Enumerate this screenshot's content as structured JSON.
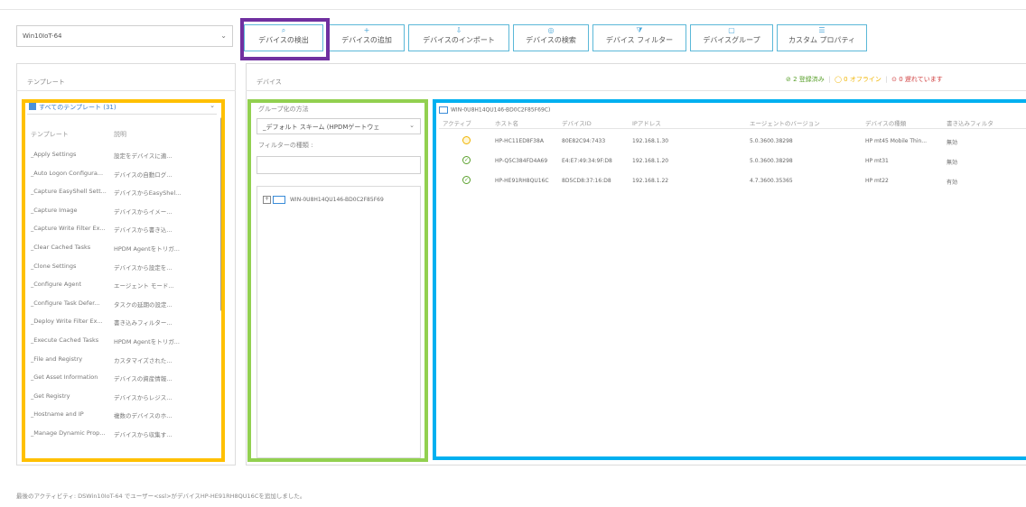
{
  "os_select": {
    "value": "Win10IoT-64"
  },
  "toolbar": [
    {
      "key": "detect",
      "label": "デバイスの検出",
      "icon": "search-icon",
      "glyph": "⌕"
    },
    {
      "key": "add",
      "label": "デバイスの追加",
      "icon": "plus-icon",
      "glyph": "+"
    },
    {
      "key": "import",
      "label": "デバイスのインポート",
      "icon": "import-icon",
      "glyph": "⇩"
    },
    {
      "key": "search",
      "label": "デバイスの検索",
      "icon": "find-icon",
      "glyph": "◎"
    },
    {
      "key": "filter",
      "label": "デバイス フィルター",
      "icon": "filter-icon",
      "glyph": "⧩"
    },
    {
      "key": "group",
      "label": "デバイスグループ",
      "icon": "group-icon",
      "glyph": "▢"
    },
    {
      "key": "props",
      "label": "カスタム プロパティ",
      "icon": "properties-icon",
      "glyph": "☰"
    }
  ],
  "templates": {
    "title": "テンプレート",
    "dropdown": "すべてのテンプレート (31)",
    "col_name": "テンプレート",
    "col_desc": "説明",
    "rows": [
      {
        "name": "_Apply Settings",
        "desc": "設定をデバイスに適..."
      },
      {
        "name": "_Auto Logon Configura...",
        "desc": "デバイスの自動ログ..."
      },
      {
        "name": "_Capture EasyShell Sett...",
        "desc": "デバイスからEasyShel..."
      },
      {
        "name": "_Capture Image",
        "desc": "デバイスからイメー..."
      },
      {
        "name": "_Capture Write Filter Ex...",
        "desc": "デバイスから書き込..."
      },
      {
        "name": "_Clear Cached Tasks",
        "desc": "HPDM Agentをトリガ..."
      },
      {
        "name": "_Clone Settings",
        "desc": "デバイスから設定を..."
      },
      {
        "name": "_Configure Agent",
        "desc": "エージェント モード..."
      },
      {
        "name": "_Configure Task Defer...",
        "desc": "タスクの延期の設定..."
      },
      {
        "name": "_Deploy Write Filter Ex...",
        "desc": "書き込みフィルター..."
      },
      {
        "name": "_Execute Cached Tasks",
        "desc": "HPDM Agentをトリガ..."
      },
      {
        "name": "_File and Registry",
        "desc": "カスタマイズされた..."
      },
      {
        "name": "_Get Asset Information",
        "desc": "デバイスの資産情報..."
      },
      {
        "name": "_Get Registry",
        "desc": "デバイスからレジス..."
      },
      {
        "name": "_Hostname and IP",
        "desc": "複数のデバイスのホ..."
      },
      {
        "name": "_Manage Dynamic Prop...",
        "desc": "デバイスから収集す..."
      }
    ]
  },
  "devices": {
    "title": "デバイス",
    "status": {
      "registered": "2 登録済み",
      "waiting": "0 オフライン",
      "off": "0 遅れています"
    },
    "group_method_label": "グループ化の方法",
    "group_method_value": "_デフォルト スキーム (HPDMゲートウェ",
    "filter_label": "フィルターの種類 :",
    "filter_value": "",
    "tree_node": "WIN-0U8H14QU146-BD0C2F85F69",
    "group_title": "WIN-0U8H14QU146-BD0C2F85F69C)",
    "columns": [
      "アクティブ",
      "ホスト名",
      "デバイスID",
      "IPアドレス",
      "エージェントのバージョン",
      "デバイスの種類",
      "書き込みフィルタ"
    ],
    "rows": [
      {
        "status": "wait",
        "host": "HP-HC11ED8F38A",
        "id": "80E82C94:7433",
        "ip": "192.168.1.30",
        "agent": "5.0.3600.38298",
        "type": "HP mt45 Mobile Thin...",
        "wf": "無効"
      },
      {
        "status": "ok",
        "host": "HP-Q5C384FD4A69",
        "id": "E4:E7:49:34:9F:D8",
        "ip": "192.168.1.20",
        "agent": "5.0.3600.38298",
        "type": "HP mt31",
        "wf": "無効"
      },
      {
        "status": "ok",
        "host": "HP-HE91RH8QU16C",
        "id": "8D5CD8:37:16:D8",
        "ip": "192.168.1.22",
        "agent": "4.7.3600.35365",
        "type": "HP mt22",
        "wf": "有効"
      }
    ]
  },
  "footer": "最後のアクティビティ: DSWin10IoT-64 でユーザー<ssl>がデバイスHP-HE91RH8QU16Cを追加しました。",
  "colors": {
    "purple": "#7030a0",
    "orange": "#ffc000",
    "green": "#92d050",
    "blue": "#00b0f0"
  }
}
